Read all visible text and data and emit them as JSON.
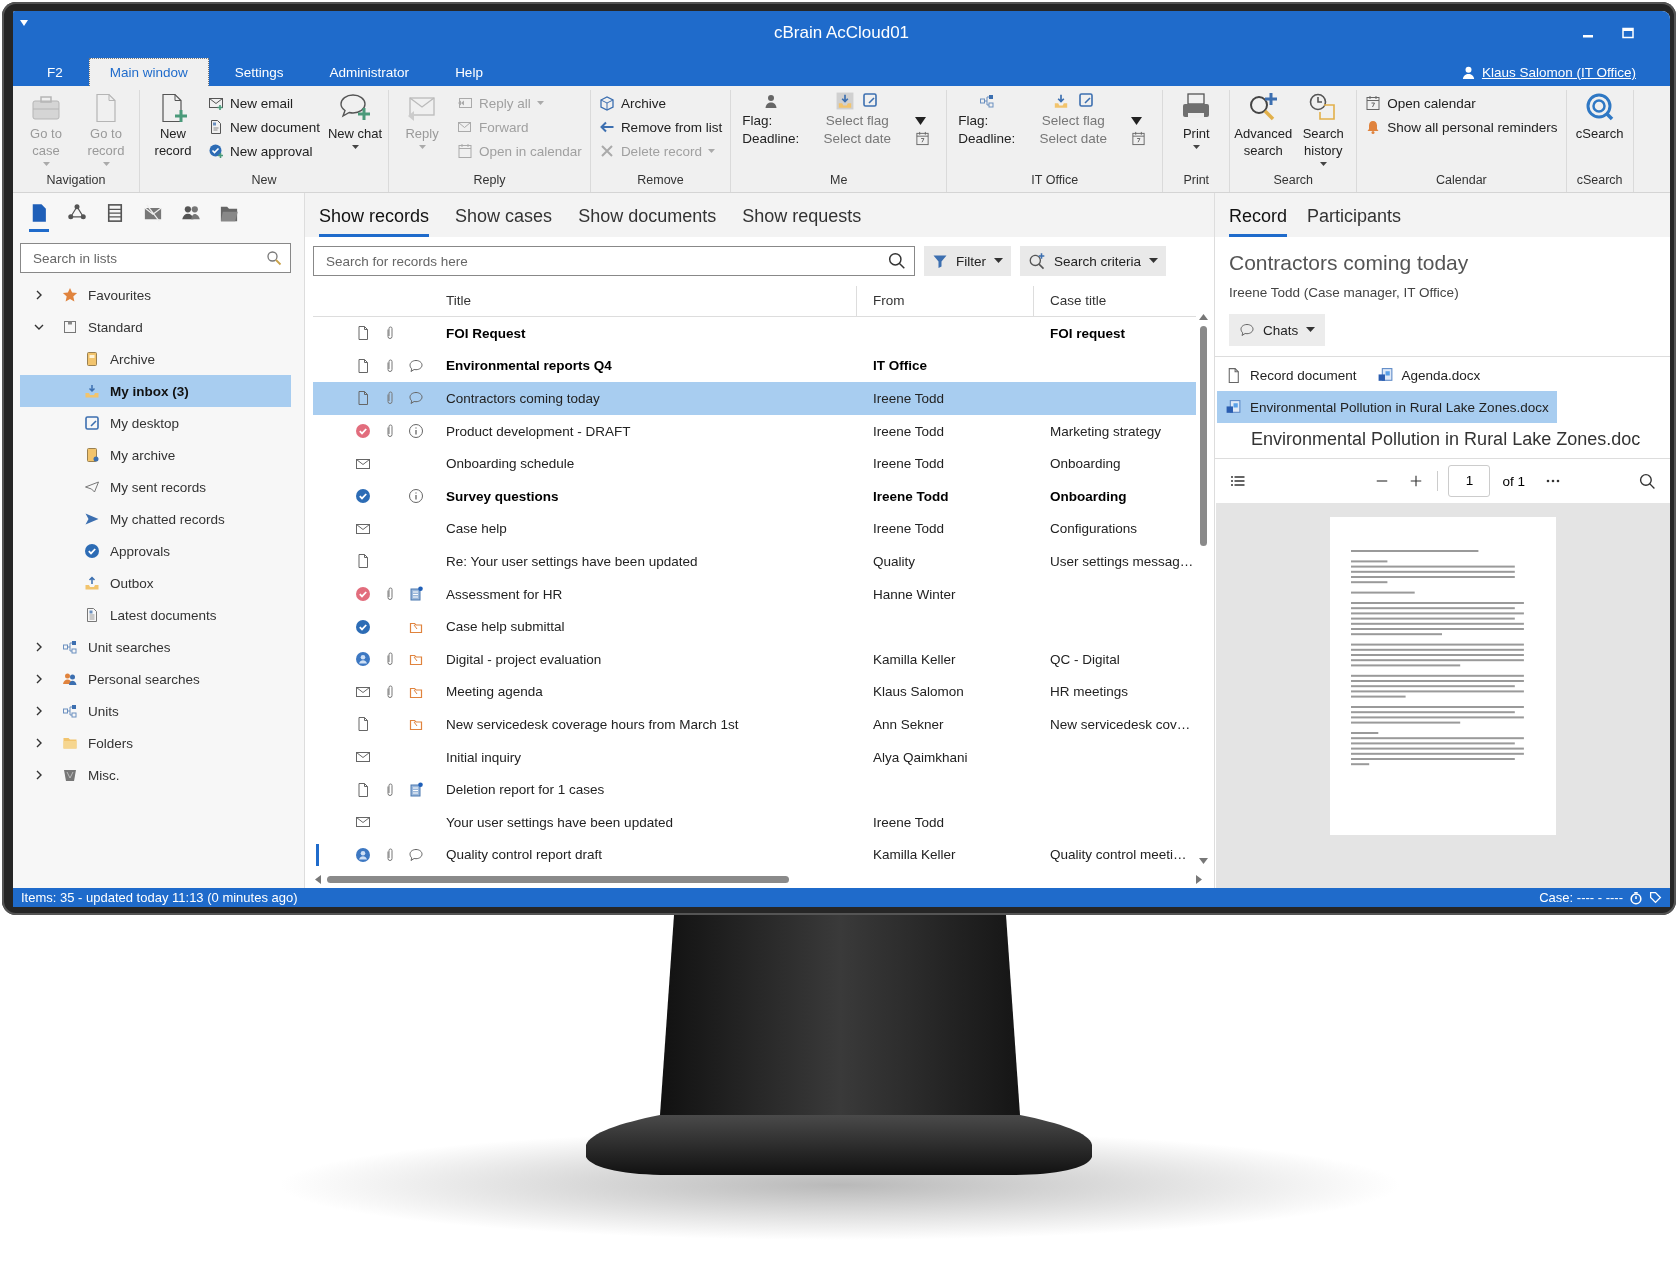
{
  "window": {
    "title": "cBrain AcCloud01",
    "user": "Klaus Salomon (IT Office)"
  },
  "menu_tabs": [
    {
      "label": "F2",
      "selected": false
    },
    {
      "label": "Main window",
      "selected": true
    },
    {
      "label": "Settings",
      "selected": false
    },
    {
      "label": "Administrator",
      "selected": false
    },
    {
      "label": "Help",
      "selected": false
    }
  ],
  "ribbon": [
    {
      "label": "Navigation",
      "items": [
        {
          "kind": "large",
          "label": "Go to case",
          "disabled": true,
          "dropdown": true
        },
        {
          "kind": "large",
          "label": "Go to record",
          "disabled": true,
          "dropdown": true
        }
      ]
    },
    {
      "label": "New",
      "items": [
        {
          "kind": "large",
          "label": "New record",
          "disabled": false,
          "dropdown": false
        },
        {
          "kind": "stack",
          "entries": [
            {
              "label": "New email",
              "disabled": false,
              "dropdown": false
            },
            {
              "label": "New document",
              "disabled": false,
              "dropdown": false
            },
            {
              "label": "New approval",
              "disabled": false,
              "dropdown": false
            }
          ]
        },
        {
          "kind": "large",
          "label": "New chat",
          "disabled": false,
          "dropdown": true
        }
      ]
    },
    {
      "label": "Reply",
      "items": [
        {
          "kind": "large",
          "label": "Reply",
          "disabled": true,
          "dropdown": true
        },
        {
          "kind": "stack",
          "entries": [
            {
              "label": "Reply all",
              "disabled": true,
              "dropdown": true
            },
            {
              "label": "Forward",
              "disabled": true,
              "dropdown": false
            },
            {
              "label": "Open in calendar",
              "disabled": true,
              "dropdown": false
            }
          ]
        }
      ]
    },
    {
      "label": "Remove",
      "items": [
        {
          "kind": "stack",
          "entries": [
            {
              "label": "Archive",
              "disabled": false,
              "dropdown": false
            },
            {
              "label": "Remove from list",
              "disabled": false,
              "dropdown": false
            },
            {
              "label": "Delete record",
              "disabled": true,
              "dropdown": true
            }
          ]
        }
      ]
    },
    {
      "label": "Me",
      "items": [
        {
          "kind": "flag",
          "flag_label": "Flag:",
          "flag_value": "Select flag",
          "deadline_label": "Deadline:",
          "deadline_value": "Select date"
        }
      ]
    },
    {
      "label": "IT Office",
      "items": [
        {
          "kind": "flag",
          "flag_label": "Flag:",
          "flag_value": "Select flag",
          "deadline_label": "Deadline:",
          "deadline_value": "Select date"
        }
      ]
    },
    {
      "label": "Print",
      "items": [
        {
          "kind": "large",
          "label": "Print",
          "disabled": false,
          "dropdown": true
        }
      ]
    },
    {
      "label": "Search",
      "items": [
        {
          "kind": "large",
          "label": "Advanced search",
          "disabled": false,
          "dropdown": false
        },
        {
          "kind": "large",
          "label": "Search history",
          "disabled": false,
          "dropdown": true
        }
      ]
    },
    {
      "label": "Calendar",
      "items": [
        {
          "kind": "stack",
          "entries": [
            {
              "label": "Open calendar",
              "disabled": false,
              "dropdown": false
            },
            {
              "label": "Show all personal reminders",
              "disabled": false,
              "dropdown": false
            }
          ]
        }
      ]
    },
    {
      "label": "cSearch",
      "items": [
        {
          "kind": "large",
          "label": "cSearch",
          "disabled": false,
          "dropdown": false
        }
      ]
    }
  ],
  "sidebar": {
    "tabs": [
      {
        "selected": true
      },
      {
        "selected": false
      },
      {
        "selected": false
      },
      {
        "selected": false
      },
      {
        "selected": false
      },
      {
        "selected": false
      }
    ],
    "search": {
      "placeholder": "Search in lists"
    },
    "tree": [
      {
        "label": "Favourites",
        "expanded": false,
        "selected": false
      },
      {
        "label": "Standard",
        "expanded": true,
        "selected": false,
        "children": [
          {
            "label": "Archive",
            "selected": false
          },
          {
            "label": "My inbox (3)",
            "selected": true
          },
          {
            "label": "My desktop",
            "selected": false
          },
          {
            "label": "My archive",
            "selected": false
          },
          {
            "label": "My sent records",
            "selected": false
          },
          {
            "label": "My chatted records",
            "selected": false
          },
          {
            "label": "Approvals",
            "selected": false
          },
          {
            "label": "Outbox",
            "selected": false
          },
          {
            "label": "Latest documents",
            "selected": false
          }
        ]
      },
      {
        "label": "Unit searches",
        "expanded": false,
        "selected": false
      },
      {
        "label": "Personal searches",
        "expanded": false,
        "selected": false
      },
      {
        "label": "Units",
        "expanded": false,
        "selected": false
      },
      {
        "label": "Folders",
        "expanded": false,
        "selected": false
      },
      {
        "label": "Misc.",
        "expanded": false,
        "selected": false
      }
    ]
  },
  "records": {
    "tabs": [
      {
        "label": "Show records",
        "selected": true
      },
      {
        "label": "Show cases",
        "selected": false
      },
      {
        "label": "Show documents",
        "selected": false
      },
      {
        "label": "Show requests",
        "selected": false
      }
    ],
    "search": {
      "placeholder": "Search for records here"
    },
    "filter_button": "Filter",
    "criteria_button": "Search criteria",
    "columns": [
      "Title",
      "From",
      "Case title"
    ],
    "rows": [
      {
        "kind": "document",
        "attachment": true,
        "title": "FOI Request",
        "from": "",
        "case_title": "FOI request",
        "unread": true,
        "selected": false,
        "marker": false
      },
      {
        "kind": "document",
        "attachment": true,
        "note": {
          "kind": "chat"
        },
        "title": "Environmental reports Q4",
        "from": "IT Office",
        "case_title": "",
        "unread": true,
        "selected": false,
        "marker": false
      },
      {
        "kind": "document",
        "attachment": true,
        "note": {
          "kind": "chat"
        },
        "title": "Contractors coming today",
        "from": "Ireene Todd",
        "case_title": "",
        "unread": false,
        "selected": true,
        "marker": false
      },
      {
        "kind": "approval-red",
        "attachment": true,
        "note": {
          "kind": "info"
        },
        "title": "Product development - DRAFT",
        "from": "Ireene Todd",
        "case_title": "Marketing strategy",
        "unread": false,
        "selected": false,
        "marker": false
      },
      {
        "kind": "email",
        "attachment": false,
        "title": "Onboarding schedule",
        "from": "Ireene Todd",
        "case_title": "Onboarding",
        "unread": false,
        "selected": false,
        "marker": false
      },
      {
        "kind": "approval-blue",
        "attachment": false,
        "note": {
          "kind": "info"
        },
        "title": "Survey questions",
        "from": "Ireene Todd",
        "case_title": "Onboarding",
        "unread": true,
        "selected": false,
        "marker": false
      },
      {
        "kind": "email",
        "attachment": false,
        "title": "Case help",
        "from": "Ireene Todd",
        "case_title": "Configurations",
        "unread": false,
        "selected": false,
        "marker": false
      },
      {
        "kind": "document",
        "attachment": false,
        "title": "Re: Your user settings have been updated",
        "from": "Quality",
        "case_title": "User settings messag…",
        "unread": false,
        "selected": false,
        "marker": false
      },
      {
        "kind": "approval-red",
        "attachment": true,
        "note": {
          "kind": "notes"
        },
        "title": "Assessment for HR",
        "from": "Hanne Winter",
        "case_title": "",
        "unread": false,
        "selected": false,
        "marker": false
      },
      {
        "kind": "approval-blue",
        "attachment": false,
        "note": {
          "kind": "case"
        },
        "title": "Case help submittal",
        "from": "",
        "case_title": "",
        "unread": false,
        "selected": false,
        "marker": false
      },
      {
        "kind": "user",
        "attachment": true,
        "note": {
          "kind": "case"
        },
        "title": "Digital  - project evaluation",
        "from": "Kamilla Keller",
        "case_title": "QC - Digital",
        "unread": false,
        "selected": false,
        "marker": false
      },
      {
        "kind": "email",
        "attachment": true,
        "note": {
          "kind": "case"
        },
        "title": "Meeting agenda",
        "from": "Klaus Salomon",
        "case_title": "HR meetings",
        "unread": false,
        "selected": false,
        "marker": false
      },
      {
        "kind": "document",
        "attachment": false,
        "note": {
          "kind": "case"
        },
        "title": "New servicedesk coverage hours from March 1st",
        "from": "Ann Sekner",
        "case_title": "New servicedesk cov…",
        "unread": false,
        "selected": false,
        "marker": false
      },
      {
        "kind": "email",
        "attachment": false,
        "title": "Initial inquiry",
        "from": "Alya Qaimkhani",
        "case_title": "",
        "unread": false,
        "selected": false,
        "marker": false
      },
      {
        "kind": "document",
        "attachment": true,
        "note": {
          "kind": "notes"
        },
        "title": "Deletion report for 1 cases",
        "from": "",
        "case_title": "",
        "unread": false,
        "selected": false,
        "marker": false
      },
      {
        "kind": "email",
        "attachment": false,
        "title": "Your user settings have been updated",
        "from": "Ireene Todd",
        "case_title": "",
        "unread": false,
        "selected": false,
        "marker": false
      },
      {
        "kind": "user",
        "attachment": true,
        "note": {
          "kind": "chat"
        },
        "title": "Quality control report draft",
        "from": "Kamilla Keller",
        "case_title": "Quality control meeti…",
        "unread": false,
        "selected": false,
        "marker": true
      }
    ]
  },
  "detail": {
    "tabs": [
      {
        "label": "Record",
        "selected": true
      },
      {
        "label": "Participants",
        "selected": false
      }
    ],
    "title": "Contractors coming today",
    "subtitle": "Ireene Todd (Case manager, IT Office)",
    "chats_button": "Chats",
    "documents": [
      {
        "kind": "document",
        "label": "Record document",
        "selected": false
      },
      {
        "kind": "word",
        "label": "Agenda.docx",
        "selected": false
      },
      {
        "kind": "word",
        "label": "Environmental Pollution in Rural Lake Zones.docx",
        "selected": true
      }
    ],
    "preview_title": "Environmental Pollution in Rural Lake Zones.doc",
    "page": "1",
    "page_count": "of 1"
  },
  "status_bar": {
    "left": "Items: 35 - updated today 11:13 (0 minutes ago)",
    "right": "Case: ---- - ----"
  }
}
